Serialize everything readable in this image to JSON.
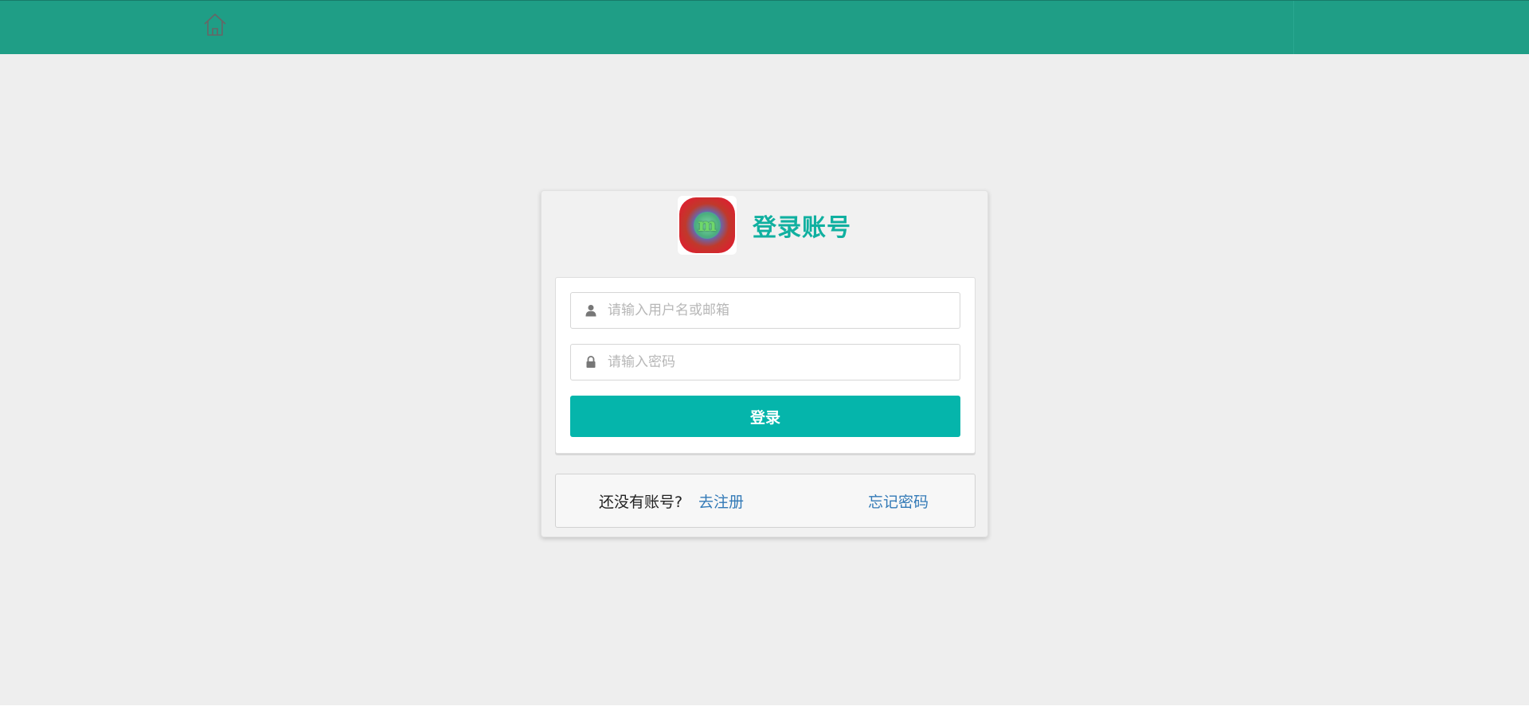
{
  "topbar": {
    "home_icon": "home-icon",
    "background": "#1f9e86"
  },
  "login": {
    "title": "登录账号",
    "logo_letter": "m",
    "username_placeholder": "请输入用户名或邮箱",
    "username_value": "",
    "username_icon": "user-icon",
    "password_placeholder": "请输入密码",
    "password_value": "",
    "password_icon": "lock-icon",
    "submit_label": "登录",
    "accent": "#05b5ab",
    "title_color": "#10b0a0"
  },
  "footer": {
    "no_account_text": "还没有账号?",
    "register_label": "去注册",
    "forgot_label": "忘记密码",
    "link_color": "#337ab7"
  }
}
